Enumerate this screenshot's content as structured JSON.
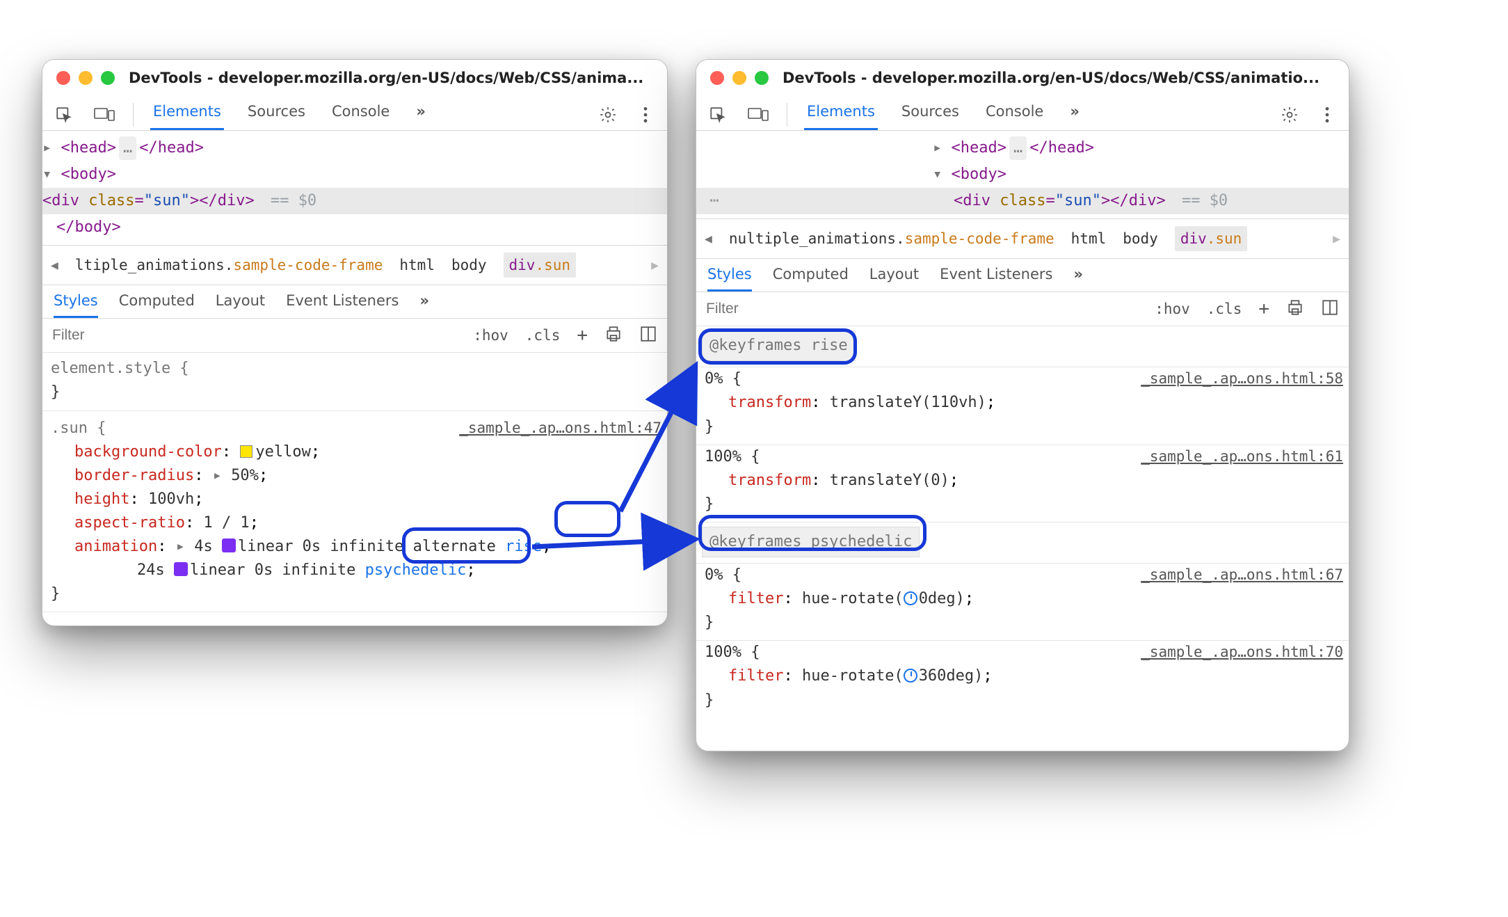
{
  "windowLeft": {
    "title": "DevTools - developer.mozilla.org/en-US/docs/Web/CSS/anima...",
    "tabs": {
      "elements": "Elements",
      "sources": "Sources",
      "console": "Console"
    },
    "dom": {
      "head_open": "<head>",
      "head_close": "</head>",
      "body_open": "<body>",
      "body_close": "</body>",
      "div_open_tag": "div",
      "div_attr_name": "class",
      "div_attr_val": "sun",
      "eq0": "== $0"
    },
    "crumbs": {
      "iframe": "ltiple_animations.",
      "iframe_cls": "sample-code-frame",
      "html": "html",
      "body": "body",
      "sel_tag": "div",
      "sel_cls": ".sun"
    },
    "subtabs": {
      "styles": "Styles",
      "computed": "Computed",
      "layout": "Layout",
      "eventlisteners": "Event Listeners"
    },
    "filter": {
      "placeholder": "Filter",
      "hov": ":hov",
      "cls": ".cls"
    },
    "styles": {
      "element_style": "element.style {",
      "sun_selector": ".sun {",
      "sun_source": "_sample_.ap…ons.html:47",
      "props": {
        "bgcolor_k": "background-color",
        "bgcolor_v": "yellow",
        "bradius_k": "border-radius",
        "bradius_v": "50%",
        "height_k": "height",
        "height_v": "100vh",
        "aspect_k": "aspect-ratio",
        "aspect_v": "1 / 1",
        "anim_k": "animation",
        "anim_line1_pre": "4s ",
        "anim_line1_ease": "linear 0s infinite alternate ",
        "anim_line1_kf": "rise",
        "anim_line2_pre": "24s ",
        "anim_line2_ease": "linear 0s infinite ",
        "anim_line2_kf": "psychedelic"
      }
    }
  },
  "windowRight": {
    "title": "DevTools - developer.mozilla.org/en-US/docs/Web/CSS/animatio...",
    "tabs": {
      "elements": "Elements",
      "sources": "Sources",
      "console": "Console"
    },
    "dom": {
      "head_open": "<head>",
      "head_close": "</head>",
      "body_open": "<body>",
      "body_close": "</body>",
      "div_open_tag": "div",
      "div_attr_name": "class",
      "div_attr_val": "sun",
      "eq0": "== $0"
    },
    "crumbs": {
      "iframe": "nultiple_animations.",
      "iframe_cls": "sample-code-frame",
      "html": "html",
      "body": "body",
      "sel_tag": "div",
      "sel_cls": ".sun"
    },
    "subtabs": {
      "styles": "Styles",
      "computed": "Computed",
      "layout": "Layout",
      "eventlisteners": "Event Listeners"
    },
    "filter": {
      "placeholder": "Filter",
      "hov": ":hov",
      "cls": ".cls"
    },
    "kf": {
      "rise_header": "@keyframes rise",
      "rise0_sel": "0% {",
      "rise0_src": "_sample_.ap…ons.html:58",
      "rise0_prop": "transform",
      "rise0_val": "translateY(110vh)",
      "rise100_sel": "100% {",
      "rise100_src": "_sample_.ap…ons.html:61",
      "rise100_prop": "transform",
      "rise100_val": "translateY(0)",
      "psy_header": "@keyframes psychedelic",
      "psy0_sel": "0% {",
      "psy0_src": "_sample_.ap…ons.html:67",
      "psy0_prop": "filter",
      "psy0_val_pre": "hue-rotate(",
      "psy0_val_deg": "0deg",
      "psy0_val_post": ")",
      "psy100_sel": "100% {",
      "psy100_src": "_sample_.ap…ons.html:70",
      "psy100_prop": "filter",
      "psy100_val_pre": "hue-rotate(",
      "psy100_val_deg": "360deg",
      "psy100_val_post": ")"
    }
  }
}
